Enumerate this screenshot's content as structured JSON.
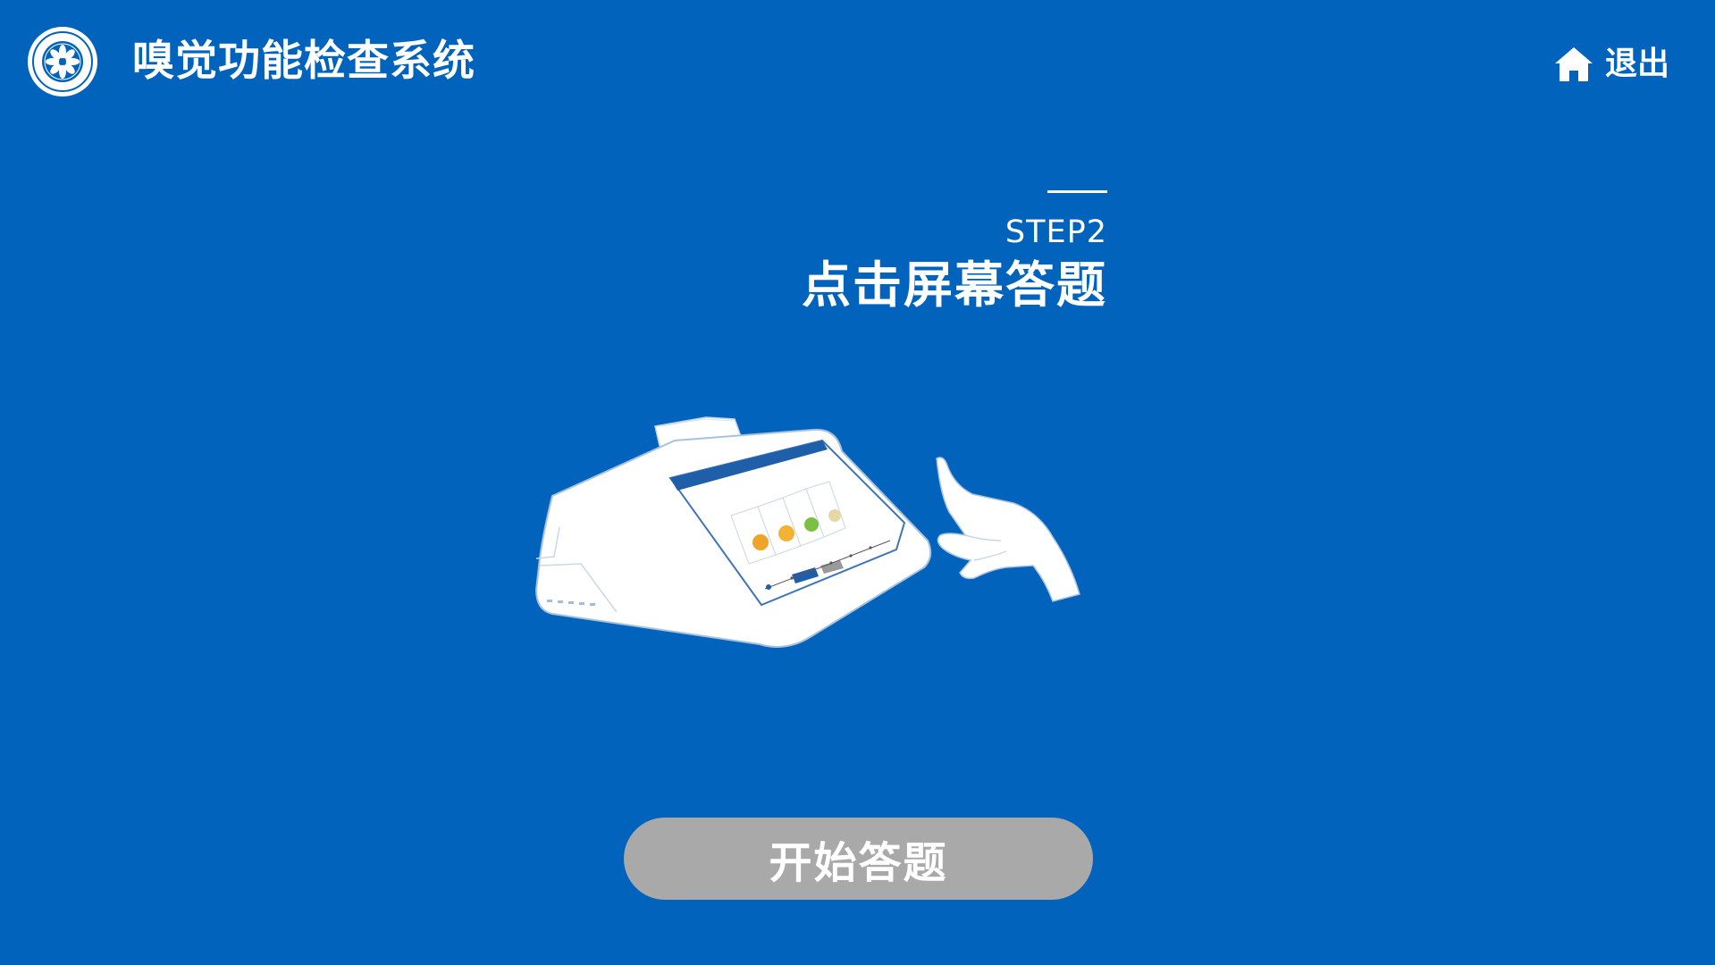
{
  "header": {
    "app_title": "嗅觉功能检查系统",
    "logo_icon": "institute-seal-logo",
    "exit_label": "退出",
    "exit_icon": "home-icon"
  },
  "step": {
    "number": "STEP2",
    "title": "点击屏幕答题"
  },
  "illustration": {
    "device_icon": "smell-test-device-illustration",
    "hand_icon": "pointing-hand-icon"
  },
  "start_button": {
    "label": "开始答题"
  },
  "colors": {
    "background": "#0263bd",
    "text": "#ffffff",
    "button": "#a9a9a9"
  }
}
